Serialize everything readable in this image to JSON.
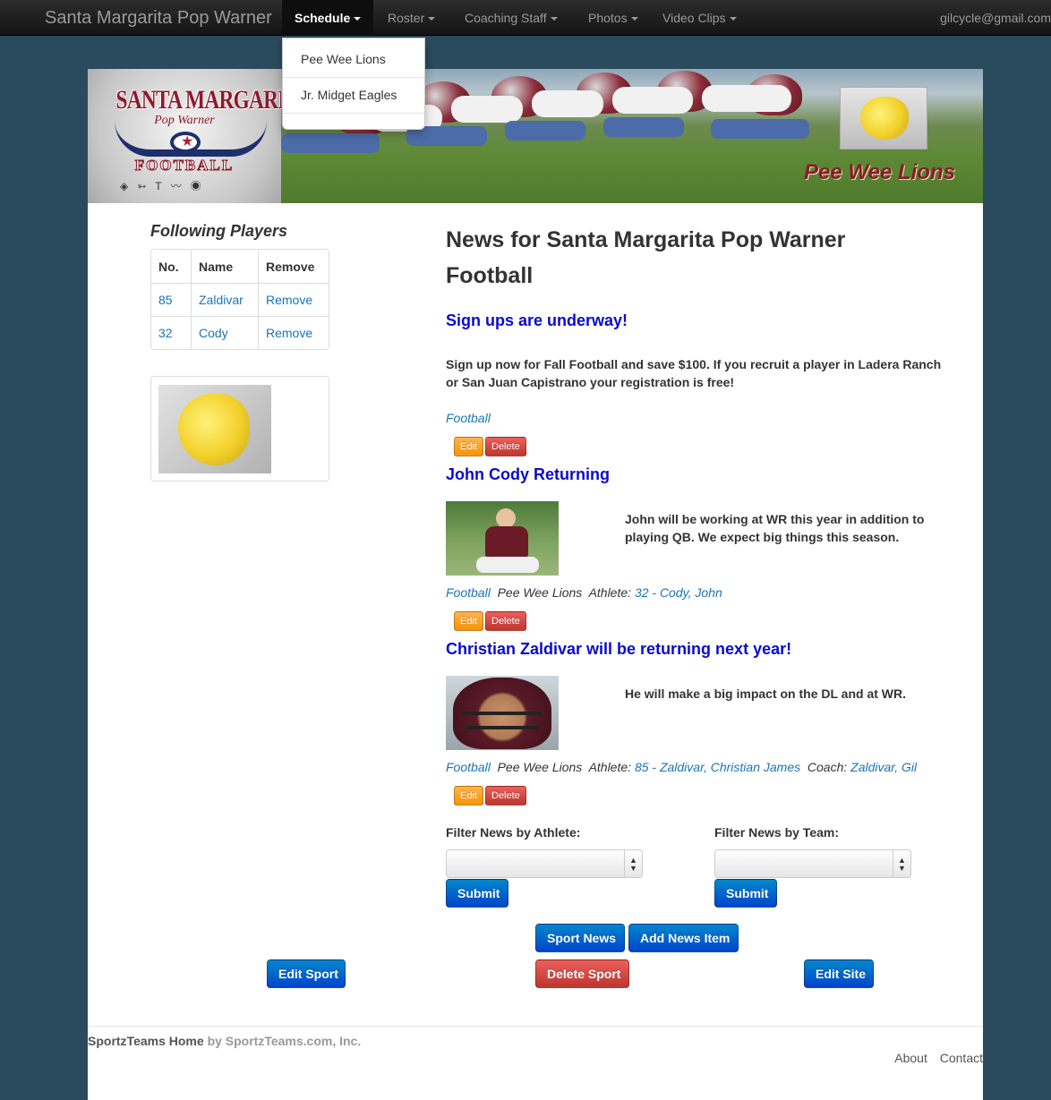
{
  "navbar": {
    "brand": "Santa Margarita Pop Warner",
    "items": [
      {
        "label": "Schedule"
      },
      {
        "label": "Roster"
      },
      {
        "label": "Coaching Staff"
      },
      {
        "label": "Photos"
      },
      {
        "label": "Video Clips"
      }
    ],
    "user": "gilcycle@gmail.com"
  },
  "schedule_dropdown": [
    "Pee Wee Lions",
    "Jr. Midget Eagles"
  ],
  "banner": {
    "logo_line1": "SANTA MARGARITA",
    "logo_line2": "Pop Warner",
    "logo_line3": "FOOTBALL",
    "team_caption": "Pee Wee Lions"
  },
  "following": {
    "title": "Following Players",
    "headers": [
      "No.",
      "Name",
      "Remove"
    ],
    "rows": [
      {
        "no": "85",
        "name": "Zaldivar",
        "remove": "Remove"
      },
      {
        "no": "32",
        "name": "Cody",
        "remove": "Remove"
      }
    ]
  },
  "page_title": "News for Santa Margarita Pop Warner Football",
  "news": [
    {
      "headline": "Sign ups are underway!",
      "body": "Sign up now for Fall Football and save $100. If you recruit a player in Ladera Ranch or San Juan Capistrano your registration is free!",
      "sport": "Football",
      "edit": "Edit",
      "delete": "Delete"
    },
    {
      "headline": "John Cody Returning",
      "body": "John will be working at WR this year in addition to playing QB. We expect big things this season.",
      "sport": "Football",
      "team": "Pee Wee Lions",
      "athlete_label": "Athlete:",
      "athlete": "32 - Cody, John",
      "edit": "Edit",
      "delete": "Delete"
    },
    {
      "headline": "Christian Zaldivar will be returning next year!",
      "body": "He will make a big impact on the DL and at WR.",
      "sport": "Football",
      "team": "Pee Wee Lions",
      "athlete_label": "Athlete:",
      "athlete": "85 - Zaldivar, Christian James",
      "coach_label": "Coach:",
      "coach": "Zaldivar, Gil",
      "edit": "Edit",
      "delete": "Delete"
    }
  ],
  "filters": {
    "athlete_label": "Filter News by Athlete:",
    "team_label": "Filter News by Team:",
    "submit": "Submit"
  },
  "actions": {
    "sport_news": "Sport News",
    "add_news_item": "Add News Item",
    "edit_sport": "Edit Sport",
    "delete_sport": "Delete Sport",
    "edit_site": "Edit Site"
  },
  "footer": {
    "home": "SportzTeams Home",
    "by": "by SportzTeams.com, Inc.",
    "about": "About",
    "contact": "Contact"
  },
  "colors": {
    "navbar": "#1b1b1b",
    "page_bg": "#2a4a5e",
    "headline": "#0a0ad1",
    "link": "#1a74b8",
    "primary": "#0066cc",
    "warning": "#f89406",
    "danger": "#bd362f"
  }
}
